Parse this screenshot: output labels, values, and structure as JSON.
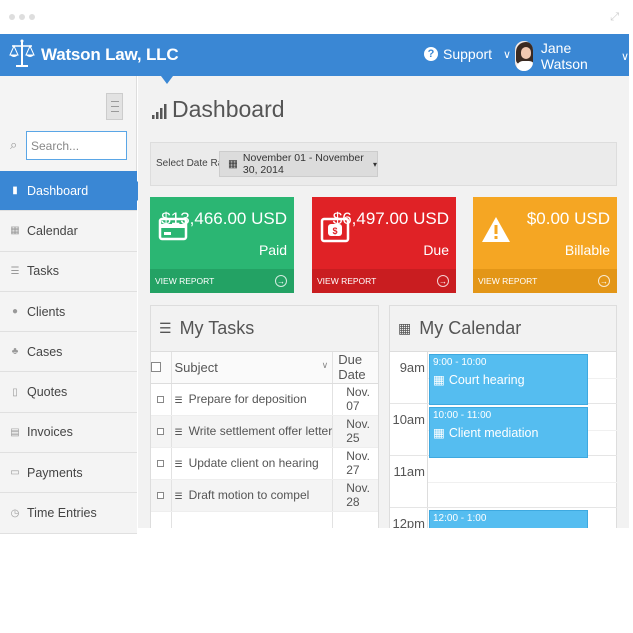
{
  "app": {
    "title": "Watson Law, LLC",
    "support_label": "Support",
    "user_name": "Jane Watson"
  },
  "colors": {
    "brand": "#3a87d4",
    "paid": "#2bb673",
    "due": "#e02226",
    "billable": "#f5a623",
    "event": "#55bdf0"
  },
  "sidebar": {
    "search_placeholder": "Search...",
    "items": [
      {
        "label": "Dashboard",
        "icon": "bar-chart-icon",
        "glyph": "▮"
      },
      {
        "label": "Calendar",
        "icon": "calendar-icon",
        "glyph": "▦"
      },
      {
        "label": "Tasks",
        "icon": "list-icon",
        "glyph": "☰"
      },
      {
        "label": "Clients",
        "icon": "users-icon",
        "glyph": "●"
      },
      {
        "label": "Cases",
        "icon": "sitemap-icon",
        "glyph": "♣"
      },
      {
        "label": "Quotes",
        "icon": "file-icon",
        "glyph": "▯"
      },
      {
        "label": "Invoices",
        "icon": "invoice-icon",
        "glyph": "▤"
      },
      {
        "label": "Payments",
        "icon": "credit-card-icon",
        "glyph": "▭"
      },
      {
        "label": "Time Entries",
        "icon": "clock-icon",
        "glyph": "◷"
      }
    ]
  },
  "dashboard": {
    "title": "Dashboard",
    "date_range_label": "Select Date Range:",
    "date_range_value": "November 01 - November 30, 2014"
  },
  "cards": [
    {
      "amount": "$13,466.00 USD",
      "label": "Paid",
      "footer": "VIEW REPORT"
    },
    {
      "amount": "$6,497.00 USD",
      "label": "Due",
      "footer": "VIEW REPORT"
    },
    {
      "amount": "$0.00 USD",
      "label": "Billable",
      "footer": "VIEW REPORT"
    }
  ],
  "tasks": {
    "title": "My Tasks",
    "col_subject": "Subject",
    "col_due": "Due Date",
    "rows": [
      {
        "subject": "Prepare for deposition",
        "due": "Nov. 07"
      },
      {
        "subject": "Write settlement offer letter",
        "due": "Nov. 25"
      },
      {
        "subject": "Update client on hearing",
        "due": "Nov. 27"
      },
      {
        "subject": "Draft motion to compel",
        "due": "Nov. 28"
      }
    ]
  },
  "calendar": {
    "title": "My Calendar",
    "hours": [
      "9am",
      "10am",
      "11am",
      "12pm"
    ],
    "events": [
      {
        "time": "9:00 - 10:00",
        "name": "Court hearing"
      },
      {
        "time": "10:00 - 11:00",
        "name": "Client mediation"
      },
      {
        "time": "12:00 - 1:00",
        "name": ""
      }
    ]
  }
}
